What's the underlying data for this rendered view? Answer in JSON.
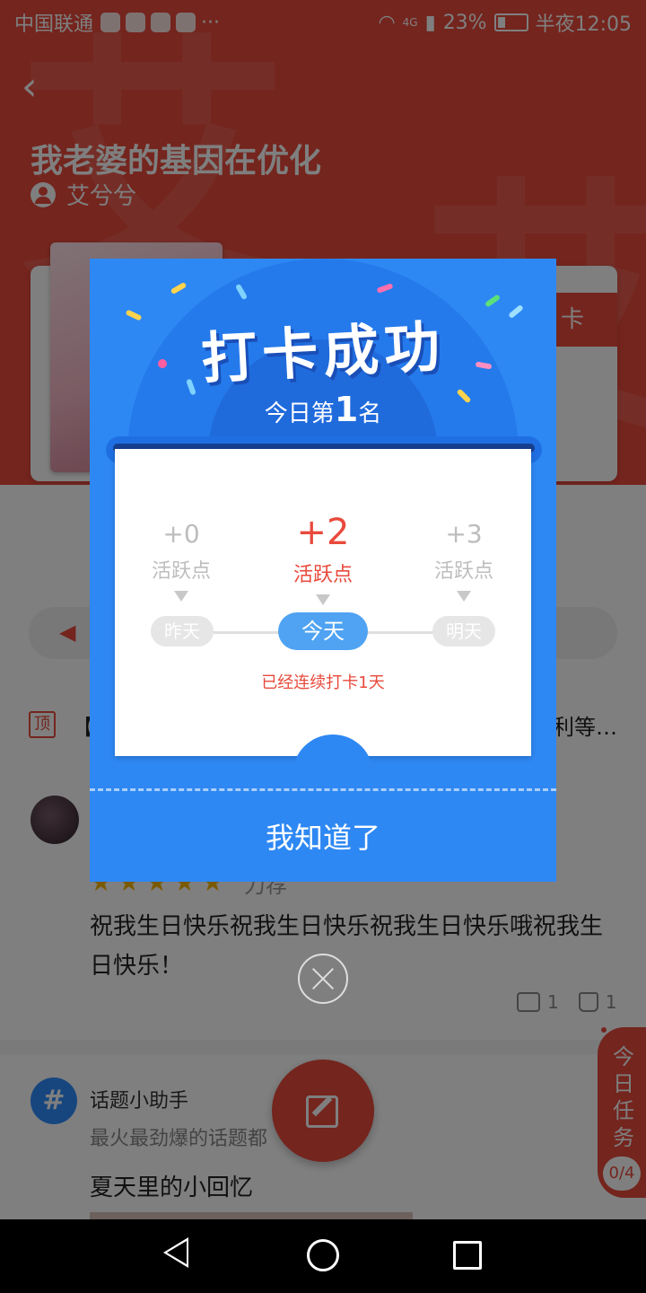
{
  "status_bar": {
    "carrier": "中国联通",
    "network": "4G",
    "battery": "23%",
    "time": "半夜12:05",
    "more": "···"
  },
  "book": {
    "title": "我老婆的基因在优化",
    "author": "艾兮兮",
    "checkin_tag": "卡"
  },
  "pinned": {
    "badge": "顶",
    "text": "【",
    "text_tail": "利等…"
  },
  "comment": {
    "stars": "★★★★★",
    "stars_label": "力荐",
    "text": "祝我生日快乐祝我生日快乐祝我生日快乐哦祝我生日快乐！",
    "reply_count": "1",
    "like_count": "1"
  },
  "topic": {
    "avatar": "#",
    "author": "话题小助手",
    "desc": "最火最劲爆的话题都",
    "title": "夏天里的小回忆"
  },
  "task_tab": {
    "label": "今日任务",
    "count": "0/4"
  },
  "dialog": {
    "title": "打卡成功",
    "rank_prefix": "今日第",
    "rank_number": "1",
    "rank_suffix": "名",
    "days": [
      {
        "value": "+0",
        "label": "活跃点",
        "day": "昨天"
      },
      {
        "value": "+2",
        "label": "活跃点",
        "day": "今天"
      },
      {
        "value": "+3",
        "label": "活跃点",
        "day": "明天"
      }
    ],
    "streak": "已经连续打卡1天",
    "confirm": "我知道了"
  },
  "colors": {
    "brand_red": "#e84a3c",
    "dialog_blue": "#2e88f3",
    "pill_blue": "#4fa3f2"
  }
}
